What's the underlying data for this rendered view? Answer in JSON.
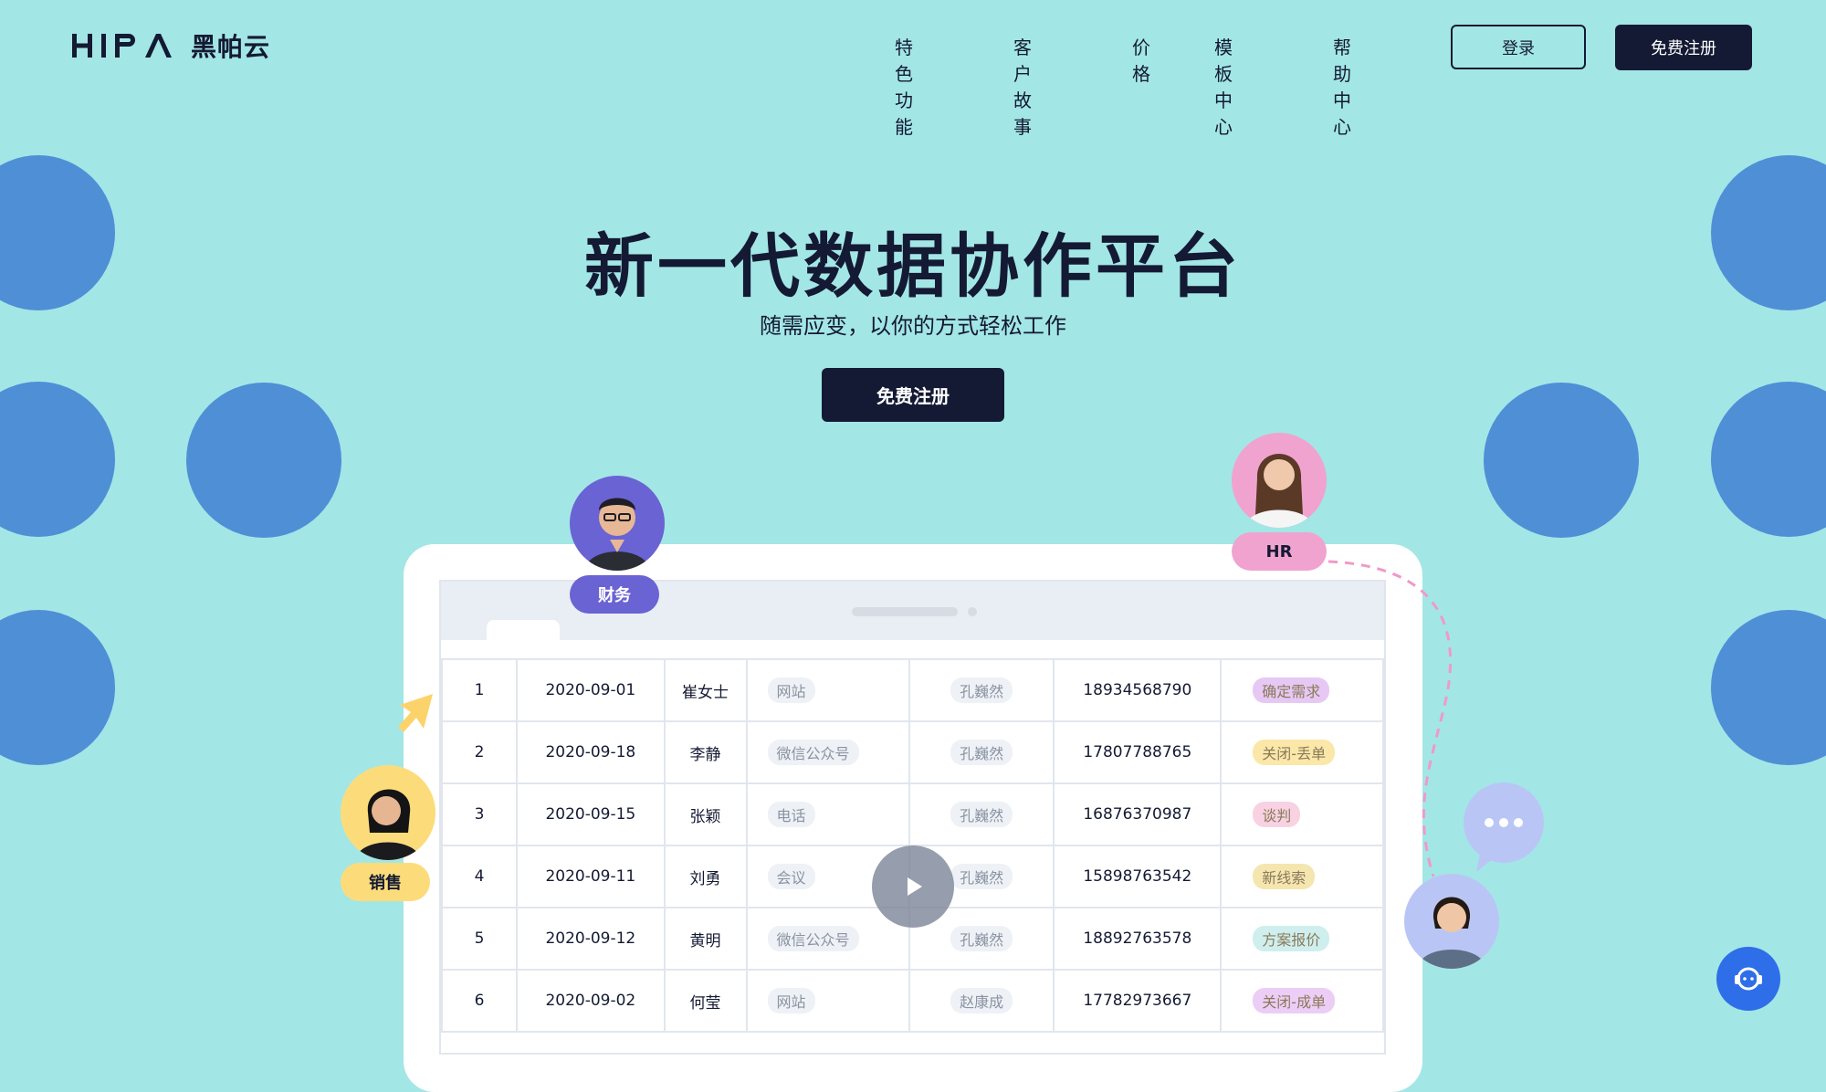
{
  "brand": {
    "mark": "HIPA",
    "name": "黑帕云"
  },
  "nav": {
    "items": [
      "特色功能",
      "客户故事",
      "价格",
      "模板中心",
      "帮助中心"
    ],
    "login": "登录",
    "signup": "免费注册"
  },
  "hero": {
    "title": "新一代数据协作平台",
    "subtitle": "随需应变，以你的方式轻松工作",
    "cta": "免费注册"
  },
  "roles": {
    "finance": "财务",
    "hr": "HR",
    "sales": "销售"
  },
  "table": {
    "rows": [
      [
        "1",
        "2020-09-01",
        "崔女士",
        "网站",
        "孔巍然",
        "18934568790",
        "确定需求"
      ],
      [
        "2",
        "2020-09-18",
        "李静",
        "微信公众号",
        "孔巍然",
        "17807788765",
        "关闭-丢单"
      ],
      [
        "3",
        "2020-09-15",
        "张颖",
        "电话",
        "孔巍然",
        "16876370987",
        "谈判"
      ],
      [
        "4",
        "2020-09-11",
        "刘勇",
        "会议",
        "孔巍然",
        "15898763542",
        "新线索"
      ],
      [
        "5",
        "2020-09-12",
        "黄明",
        "微信公众号",
        "孔巍然",
        "18892763578",
        "方案报价"
      ],
      [
        "6",
        "2020-09-02",
        "何莹",
        "网站",
        "赵康成",
        "17782973667",
        "关闭-成单"
      ]
    ],
    "status_colors": {
      "确定需求": "#e7c8f4",
      "关闭-丢单": "#fbe7a8",
      "谈判": "#f8d2e2",
      "新线索": "#f5e6b0",
      "方案报价": "#cfeeee",
      "关闭-成单": "#eccdf6"
    }
  },
  "colors": {
    "background": "#a3e6e6",
    "circle": "#4f8fd6",
    "navy": "#141a33",
    "finance": "#6a63d3",
    "hr": "#f0a3cf",
    "sales": "#fcdc7a",
    "help": "#2e6ee8"
  },
  "icons": [
    "play-icon",
    "chat-bubble-icon",
    "cursor-arrow-icon",
    "customer-service-icon"
  ]
}
